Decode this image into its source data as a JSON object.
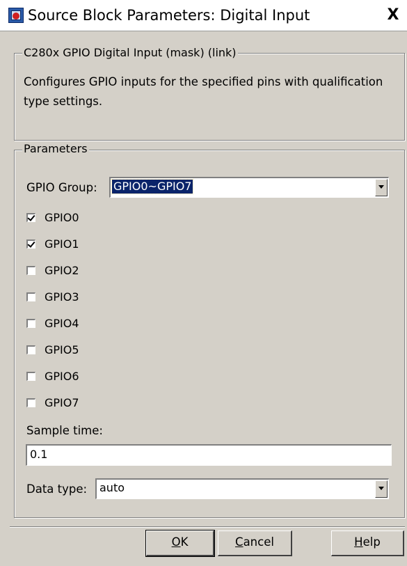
{
  "window": {
    "title": "Source Block Parameters: Digital Input",
    "close_glyph": "X"
  },
  "description_group": {
    "legend": "C280x GPIO Digital Input (mask) (link)",
    "text": "Configures GPIO inputs for the specified pins with qualification type settings."
  },
  "parameters_group": {
    "legend": "Parameters",
    "gpio_group_label": "GPIO Group:",
    "gpio_group_value": "GPIO0~GPIO7",
    "checkboxes": [
      {
        "label": "GPIO0",
        "checked": true
      },
      {
        "label": "GPIO1",
        "checked": true
      },
      {
        "label": "GPIO2",
        "checked": false
      },
      {
        "label": "GPIO3",
        "checked": false
      },
      {
        "label": "GPIO4",
        "checked": false
      },
      {
        "label": "GPIO5",
        "checked": false
      },
      {
        "label": "GPIO6",
        "checked": false
      },
      {
        "label": "GPIO7",
        "checked": false
      }
    ],
    "sample_time_label": "Sample time:",
    "sample_time_value": "0.1",
    "data_type_label": "Data type:",
    "data_type_value": "auto"
  },
  "buttons": {
    "ok": {
      "mnemonic": "O",
      "rest": "K"
    },
    "cancel": {
      "mnemonic": "C",
      "rest": "ancel"
    },
    "help": {
      "mnemonic": "H",
      "rest": "elp"
    }
  },
  "icons": {
    "app": "simulink-block-icon",
    "close": "close-icon",
    "dropdown": "chevron-down-icon"
  },
  "colors": {
    "dialog_bg": "#d4d0c8",
    "selection_bg": "#0a246a",
    "selection_fg": "#ffffff"
  }
}
